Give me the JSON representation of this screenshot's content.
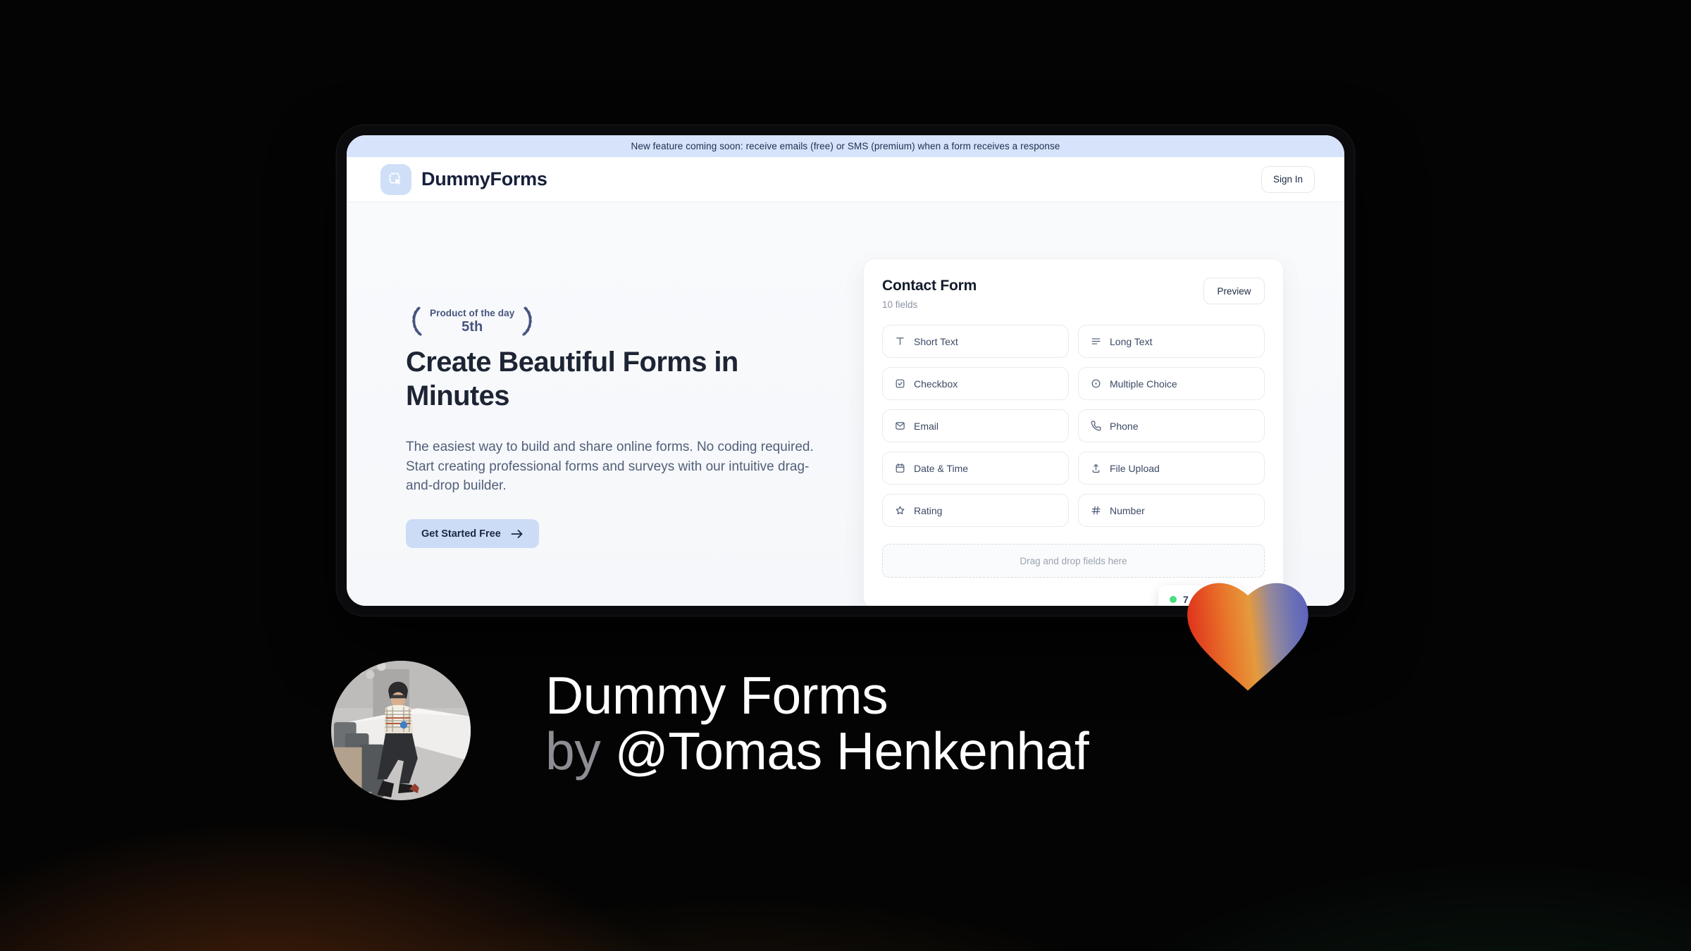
{
  "banner": {
    "text": "New feature coming soon: receive emails (free) or SMS (premium) when a form receives a response"
  },
  "header": {
    "brand": "DummyForms",
    "logo_icon": "dashed-select-cursor-icon",
    "sign_in_label": "Sign In"
  },
  "hero": {
    "award": {
      "label": "Product of the day",
      "rank": "5th",
      "left_icon": "laurel-left-icon",
      "right_icon": "laurel-right-icon"
    },
    "heading": "Create Beautiful Forms in Minutes",
    "description": "The easiest way to build and share online forms. No coding required. Start creating professional forms and surveys with our intuitive drag-and-drop builder.",
    "cta": {
      "label": "Get Started Free",
      "icon": "arrow-right-icon"
    }
  },
  "form_card": {
    "title": "Contact Form",
    "subtitle": "10 fields",
    "preview_label": "Preview",
    "fields": [
      {
        "label": "Short Text",
        "icon": "short-text-icon"
      },
      {
        "label": "Long Text",
        "icon": "long-text-icon"
      },
      {
        "label": "Checkbox",
        "icon": "checkbox-icon"
      },
      {
        "label": "Multiple Choice",
        "icon": "multiple-choice-icon"
      },
      {
        "label": "Email",
        "icon": "email-icon"
      },
      {
        "label": "Phone",
        "icon": "phone-icon"
      },
      {
        "label": "Date & Time",
        "icon": "calendar-icon"
      },
      {
        "label": "File Upload",
        "icon": "upload-icon"
      },
      {
        "label": "Rating",
        "icon": "star-icon"
      },
      {
        "label": "Number",
        "icon": "hash-icon"
      }
    ],
    "dropzone_text": "Drag and drop fields here",
    "status_badge": {
      "dot_color": "#4ade80",
      "visible_text": "7"
    }
  },
  "caption": {
    "title": "Dummy Forms",
    "by_prefix": "by ",
    "author": "@Tomas Henkenhaf"
  },
  "colors": {
    "banner_bg": "#d6e3fb",
    "accent_blue": "#ccdcf7",
    "heading_navy": "#1d2434",
    "slate_text": "#52607a",
    "laurel_slate": "#46557e",
    "status_green": "#4ade80",
    "heart_red": "#e23a20",
    "heart_orange": "#ee8c2e",
    "heart_purple": "#5c60c0"
  }
}
